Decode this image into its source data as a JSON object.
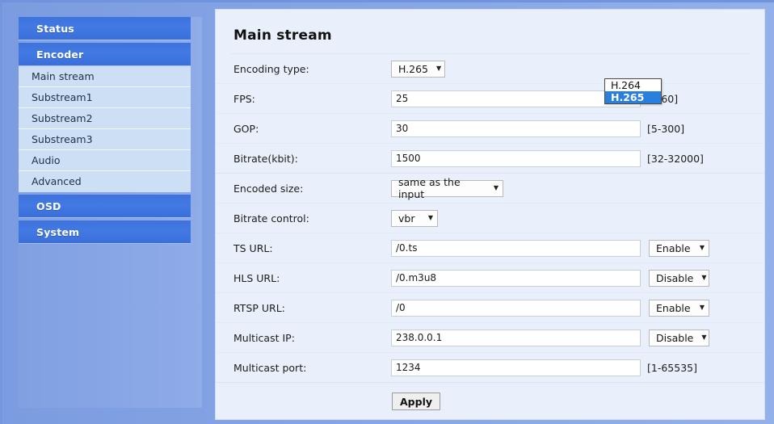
{
  "sidebar": {
    "groups": [
      {
        "label": "Status",
        "type": "head",
        "items": []
      },
      {
        "label": "Encoder",
        "type": "head",
        "items": [
          {
            "label": "Main stream"
          },
          {
            "label": "Substream1"
          },
          {
            "label": "Substream2"
          },
          {
            "label": "Substream3"
          },
          {
            "label": "Audio"
          },
          {
            "label": "Advanced"
          }
        ]
      },
      {
        "label": "OSD",
        "type": "head",
        "items": []
      },
      {
        "label": "System",
        "type": "head",
        "items": []
      }
    ]
  },
  "main": {
    "title": "Main stream",
    "fields": {
      "encoding_type": {
        "label": "Encoding type:",
        "value": "H.265"
      },
      "fps": {
        "label": "FPS:",
        "value": "25",
        "hint": "[5-60]"
      },
      "gop": {
        "label": "GOP:",
        "value": "30",
        "hint": "[5-300]"
      },
      "bitrate": {
        "label": "Bitrate(kbit):",
        "value": "1500",
        "hint": "[32-32000]"
      },
      "encoded_size": {
        "label": "Encoded size:",
        "value": "same as the input"
      },
      "bitrate_control": {
        "label": "Bitrate control:",
        "value": "vbr"
      },
      "ts_url": {
        "label": "TS URL:",
        "value": "/0.ts",
        "toggle": "Enable"
      },
      "hls_url": {
        "label": "HLS URL:",
        "value": "/0.m3u8",
        "toggle": "Disable"
      },
      "rtsp_url": {
        "label": "RTSP URL:",
        "value": "/0",
        "toggle": "Enable"
      },
      "multicast_ip": {
        "label": "Multicast IP:",
        "value": "238.0.0.1",
        "toggle": "Disable"
      },
      "multicast_port": {
        "label": "Multicast port:",
        "value": "1234",
        "hint": "[1-65535]"
      }
    },
    "dropdown_open": {
      "options": [
        "H.264",
        "H.265"
      ],
      "selected": "H.265"
    },
    "apply_label": "Apply"
  }
}
